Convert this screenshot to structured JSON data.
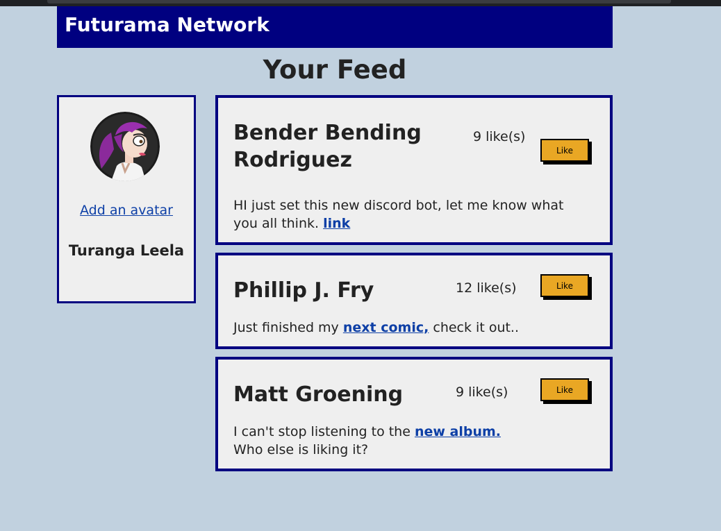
{
  "app": {
    "brand": "Futurama Network"
  },
  "page": {
    "title": "Your Feed"
  },
  "colors": {
    "background": "#c1d1df",
    "navbar": "#000080",
    "card_border": "#000080",
    "card_background": "#efefef",
    "like_button": "#e9a724",
    "link": "#0d3fa6"
  },
  "profile": {
    "avatar_icon": "purple-haired-character-avatar",
    "add_avatar_link": "Add an avatar",
    "name": "Turanga Leela"
  },
  "posts": [
    {
      "author": "Bender Bending Rodriguez",
      "likes": "9 like(s)",
      "like_label": "Like",
      "text_before": "HI just set this new discord bot, let me know what you all think. ",
      "link_text": "link",
      "text_after": "",
      "text_line2": ""
    },
    {
      "author": "Phillip J. Fry",
      "likes": "12 like(s)",
      "like_label": "Like",
      "text_before": "Just finished my ",
      "link_text": "next comic,",
      "text_after": " check it out..",
      "text_line2": ""
    },
    {
      "author": "Matt Groening",
      "likes": "9 like(s)",
      "like_label": "Like",
      "text_before": "I can't stop listening to the ",
      "link_text": "new album.",
      "text_after": "",
      "text_line2": "Who else is liking it?"
    }
  ]
}
